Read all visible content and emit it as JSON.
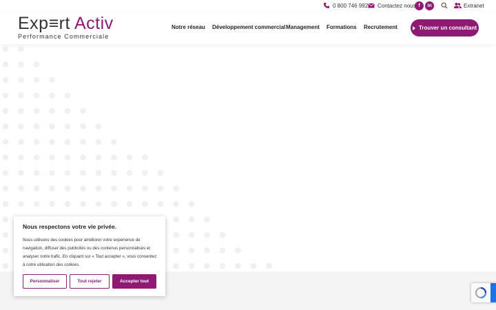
{
  "topbar": {
    "phone": "0 800 746 992",
    "contact": "Contactez nous",
    "social": [
      {
        "icon": "facebook-icon",
        "label": "f"
      },
      {
        "icon": "linkedin-icon",
        "label": "in"
      }
    ],
    "extranet": "Extranet"
  },
  "header": {
    "logo_part1": "Exp≡rt",
    "logo_part2": " Activ",
    "logo_tagline": "Performance Commerciale",
    "nav": [
      "Notre réseau",
      "Développement commercial",
      "Management",
      "Formations",
      "Recrutement"
    ],
    "cta": "Trouver un consultant"
  },
  "cookie": {
    "title": "Nous respectons votre vie privée.",
    "text": "Nous utilisons des cookies pour améliorer votre expérience de navigation, diffuser des publicités ou des contenus personnalisés et analyser notre trafic. En cliquant sur « Tout accepter », vous consentez à notre utilisation des cookies.",
    "btn_customize": "Personnaliser",
    "btn_reject": "Tout rejeter",
    "btn_accept": "Accepter tout"
  },
  "colors": {
    "brand": "#8e1a74",
    "dots": "#f0f0f3"
  }
}
